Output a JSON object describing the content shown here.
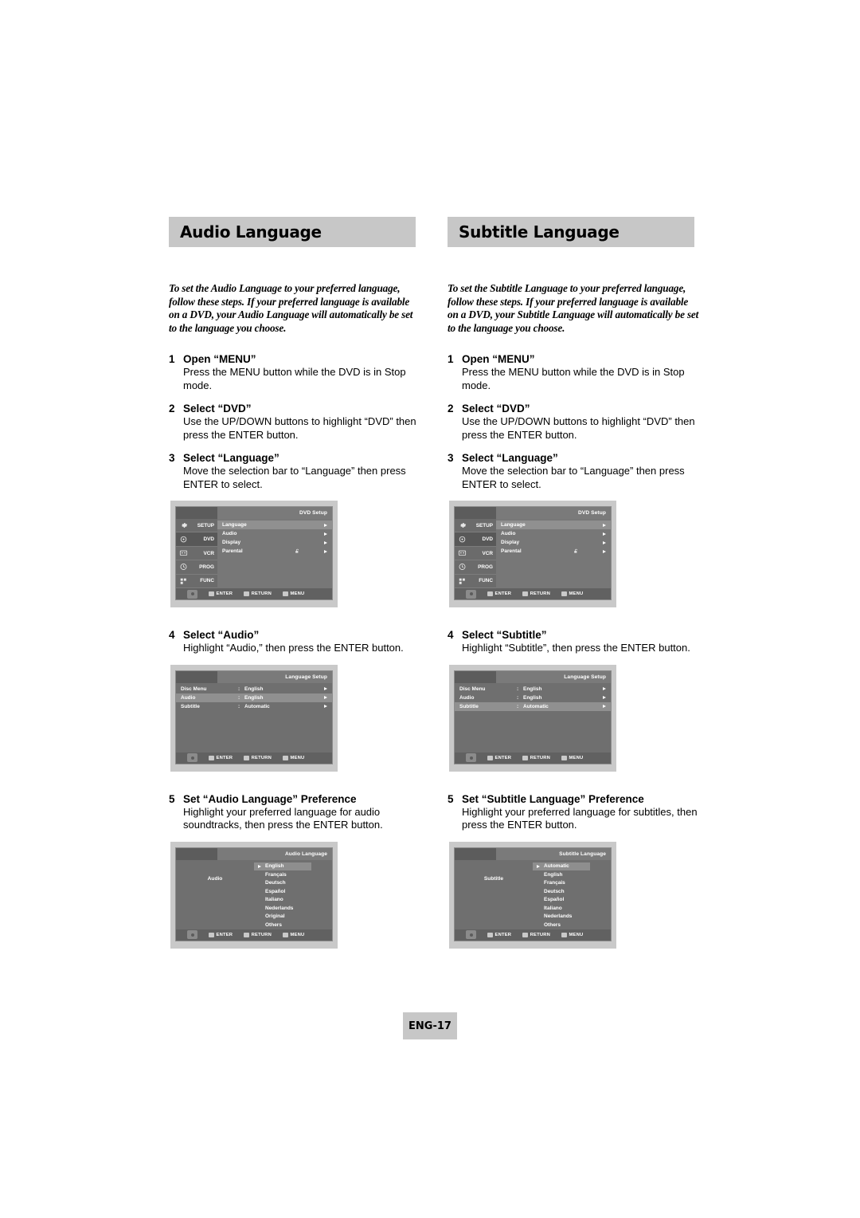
{
  "page": {
    "footer_label": "ENG-17",
    "band_color": "#c7c7c7"
  },
  "columns": [
    {
      "id": "audio",
      "heading": "Audio Language",
      "intro": "To set the Audio Language to your preferred language, follow these steps. If your preferred language is available on a DVD, your Audio Language will automatically be set to the language you choose.",
      "steps": [
        {
          "num": "1",
          "title": "Open “MENU”",
          "body": "Press the MENU button while the DVD is in Stop mode."
        },
        {
          "num": "2",
          "title": "Select “DVD”",
          "body": "Use the UP/DOWN buttons to highlight “DVD” then press the ENTER button."
        },
        {
          "num": "3",
          "title": "Select “Language”",
          "body": "Move the selection bar to “Language” then press ENTER to select."
        },
        {
          "num": "4",
          "title": "Select “Audio”",
          "body": "Highlight “Audio,” then press the ENTER button."
        },
        {
          "num": "5",
          "title": "Set “Audio Language” Preference",
          "body": "Highlight your preferred language for audio soundtracks, then press the ENTER button."
        }
      ],
      "setup_screen": {
        "title": "DVD Setup",
        "rail": [
          {
            "label": "SETUP",
            "icon": "gear-icon",
            "active": false
          },
          {
            "label": "DVD",
            "icon": "disc-icon",
            "active": true
          },
          {
            "label": "VCR",
            "icon": "cassette-icon",
            "active": false
          },
          {
            "label": "PROG",
            "icon": "clock-icon",
            "active": false
          },
          {
            "label": "FUNC",
            "icon": "function-icon",
            "active": false
          }
        ],
        "rows": [
          {
            "label": "Language",
            "selected": true,
            "lock": false
          },
          {
            "label": "Audio",
            "selected": false,
            "lock": false
          },
          {
            "label": "Display",
            "selected": false,
            "lock": false
          },
          {
            "label": "Parental",
            "selected": false,
            "lock": true
          }
        ]
      },
      "language_screen": {
        "title": "Language Setup",
        "rows": [
          {
            "label": "Disc Menu",
            "colon": ":",
            "value": "English",
            "selected": false
          },
          {
            "label": "Audio",
            "colon": ":",
            "value": "English",
            "selected": true
          },
          {
            "label": "Subtitle",
            "colon": ":",
            "value": "Automatic",
            "selected": false
          }
        ]
      },
      "list_screen": {
        "title": "Audio Language",
        "side_label": "Audio",
        "items": [
          {
            "label": "English",
            "selected": true
          },
          {
            "label": "Français",
            "selected": false
          },
          {
            "label": "Deutsch",
            "selected": false
          },
          {
            "label": "Español",
            "selected": false
          },
          {
            "label": "Italiano",
            "selected": false
          },
          {
            "label": "Nederlands",
            "selected": false
          },
          {
            "label": "Original",
            "selected": false
          },
          {
            "label": "Others",
            "selected": false
          }
        ]
      }
    },
    {
      "id": "subtitle",
      "heading": "Subtitle Language",
      "intro": "To set the Subtitle Language to your preferred language, follow these steps. If your preferred language is available on a DVD, your Subtitle Language will automatically be set to the language you choose.",
      "steps": [
        {
          "num": "1",
          "title": "Open “MENU”",
          "body": "Press the MENU button while the DVD is in Stop mode."
        },
        {
          "num": "2",
          "title": "Select “DVD”",
          "body": "Use the UP/DOWN buttons to highlight “DVD” then press the ENTER button."
        },
        {
          "num": "3",
          "title": "Select “Language”",
          "body": "Move the selection bar to “Language” then press ENTER to select."
        },
        {
          "num": "4",
          "title": "Select “Subtitle”",
          "body": "Highlight “Subtitle”, then press the ENTER button."
        },
        {
          "num": "5",
          "title": "Set “Subtitle Language” Preference",
          "body": "Highlight your preferred language for subtitles, then press the ENTER button."
        }
      ],
      "setup_screen": {
        "title": "DVD Setup",
        "rail": [
          {
            "label": "SETUP",
            "icon": "gear-icon",
            "active": false
          },
          {
            "label": "DVD",
            "icon": "disc-icon",
            "active": true
          },
          {
            "label": "VCR",
            "icon": "cassette-icon",
            "active": false
          },
          {
            "label": "PROG",
            "icon": "clock-icon",
            "active": false
          },
          {
            "label": "FUNC",
            "icon": "function-icon",
            "active": false
          }
        ],
        "rows": [
          {
            "label": "Language",
            "selected": true,
            "lock": false
          },
          {
            "label": "Audio",
            "selected": false,
            "lock": false
          },
          {
            "label": "Display",
            "selected": false,
            "lock": false
          },
          {
            "label": "Parental",
            "selected": false,
            "lock": true
          }
        ]
      },
      "language_screen": {
        "title": "Language Setup",
        "rows": [
          {
            "label": "Disc Menu",
            "colon": ":",
            "value": "English",
            "selected": false
          },
          {
            "label": "Audio",
            "colon": ":",
            "value": "English",
            "selected": false
          },
          {
            "label": "Subtitle",
            "colon": ":",
            "value": "Automatic",
            "selected": true
          }
        ]
      },
      "list_screen": {
        "title": "Subtitle Language",
        "side_label": "Subtitle",
        "items": [
          {
            "label": "Automatic",
            "selected": true
          },
          {
            "label": "English",
            "selected": false
          },
          {
            "label": "Français",
            "selected": false
          },
          {
            "label": "Deutsch",
            "selected": false
          },
          {
            "label": "Español",
            "selected": false
          },
          {
            "label": "Italiano",
            "selected": false
          },
          {
            "label": "Nederlands",
            "selected": false
          },
          {
            "label": "Others",
            "selected": false
          }
        ]
      }
    }
  ],
  "osd_bottom_hints": [
    {
      "label": "ENTER",
      "icon": "enter-key-icon"
    },
    {
      "label": "RETURN",
      "icon": "return-key-icon"
    },
    {
      "label": "MENU",
      "icon": "menu-key-icon"
    }
  ]
}
